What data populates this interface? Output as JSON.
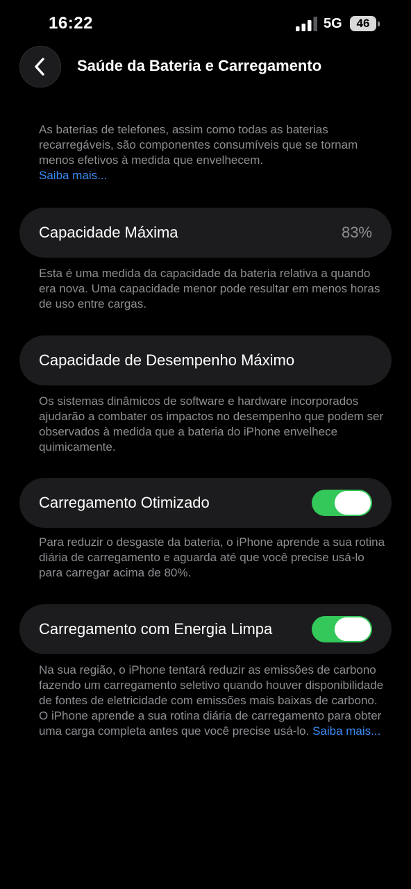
{
  "status_bar": {
    "time": "16:22",
    "network": "5G",
    "battery_level": "46"
  },
  "nav": {
    "back_icon": "chevron-left-icon",
    "title": "Saúde da Bateria e Carregamento"
  },
  "intro": {
    "text": "As baterias de telefones, assim como todas as baterias recarregáveis, são componentes consumíveis que se tornam menos efetivos à medida que envelhecem.",
    "link": "Saiba mais..."
  },
  "max_capacity": {
    "label": "Capacidade Máxima",
    "value": "83%",
    "description": "Esta é uma medida da capacidade da bateria relativa a quando era nova. Uma capacidade menor pode resultar em menos horas de uso entre cargas."
  },
  "peak_performance": {
    "label": "Capacidade de Desempenho Máximo",
    "description": "Os sistemas dinâmicos de software e hardware incorporados ajudarão a combater os impactos no desempenho que podem ser observados à medida que a bateria do iPhone envelhece quimicamente."
  },
  "optimized_charging": {
    "label": "Carregamento Otimizado",
    "enabled": true,
    "description": "Para reduzir o desgaste da bateria, o iPhone aprende a sua rotina diária de carregamento e aguarda até que você precise usá-lo para carregar acima de 80%."
  },
  "clean_energy": {
    "label": "Carregamento com Energia Limpa",
    "enabled": true,
    "description": "Na sua região, o iPhone tentará reduzir as emissões de carbono fazendo um carregamento seletivo quando houver disponibilidade de fontes de eletricidade com emissões mais baixas de carbono. O iPhone aprende a sua rotina diária de carregamento para obter uma carga completa antes que você precise usá-lo.",
    "link": "Saiba mais..."
  },
  "colors": {
    "background": "#000000",
    "card": "#1c1c1e",
    "secondary_text": "#8e8e93",
    "link": "#3b8cf5",
    "toggle_on": "#34c759"
  }
}
